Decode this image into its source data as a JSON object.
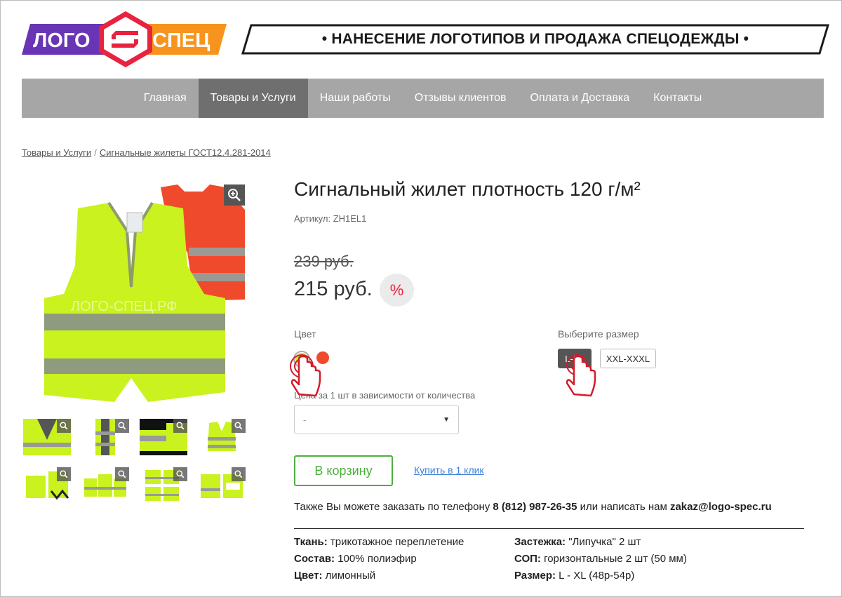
{
  "header": {
    "logo_left": "ЛОГО",
    "logo_right": "СПЕЦ",
    "slogan": "• НАНЕСЕНИЕ ЛОГОТИПОВ И ПРОДАЖА СПЕЦОДЕЖДЫ •"
  },
  "nav": {
    "items": [
      {
        "label": "Главная"
      },
      {
        "label": "Товары и Услуги"
      },
      {
        "label": "Наши работы"
      },
      {
        "label": "Отзывы клиентов"
      },
      {
        "label": "Оплата и Доставка"
      },
      {
        "label": "Контакты"
      }
    ],
    "active_index": 1
  },
  "breadcrumb": {
    "items": [
      "Товары и Услуги",
      "Сигнальные жилеты ГОСТ12.4.281-2014"
    ],
    "separator": "/"
  },
  "gallery": {
    "watermark": "ЛОГО-СПЕЦ.РФ",
    "zoom_icon": "zoom-in-icon"
  },
  "product": {
    "title": "Сигнальный жилет плотность 120 г/м²",
    "sku": "Артикул: ZH1EL1",
    "old_price": "239 руб.",
    "new_price": "215 руб.",
    "discount_symbol": "%",
    "color_label": "Цвет",
    "colors": [
      {
        "name": "лимонный",
        "hex": "#c9f21e",
        "selected": true
      },
      {
        "name": "оранжевый",
        "hex": "#f04a2c",
        "selected": false
      }
    ],
    "size_label": "Выберите размер",
    "sizes": [
      {
        "label": "L-XL",
        "selected": true
      },
      {
        "label": "XXL-XXXL",
        "selected": false
      }
    ],
    "qty_label": "Цена за 1 шт в зависимости от количества",
    "qty_value": "-",
    "cart_button": "В корзину",
    "one_click": "Купить в 1 клик"
  },
  "contact": {
    "prefix": "Также Вы можете заказать по телефону ",
    "phone": "8 (812) 987-26-35",
    "middle": " или написать нам ",
    "email": "zakaz@logo-spec.ru"
  },
  "specs": {
    "left": [
      {
        "key": "Ткань:",
        "value": " трикотажное переплетение"
      },
      {
        "key": "Состав:",
        "value": " 100% полиэфир"
      },
      {
        "key": "Цвет:",
        "value": " лимонный"
      }
    ],
    "right": [
      {
        "key": "Застежка:",
        "value": " \"Липучка\" 2 шт"
      },
      {
        "key": "СОП:",
        "value": " горизонтальные 2 шт (50 мм)"
      },
      {
        "key": "Размер:",
        "value": " L - XL (48р-54р)"
      }
    ]
  },
  "colors": {
    "accent_green": "#4caf3d",
    "nav_bg": "#a6a6a6",
    "nav_active": "#6f6f6f",
    "link_blue": "#3d7fd9",
    "discount_red": "#e8223f",
    "logo_purple": "#6a35b5",
    "logo_orange": "#f7941d",
    "logo_red": "#e8223f"
  }
}
